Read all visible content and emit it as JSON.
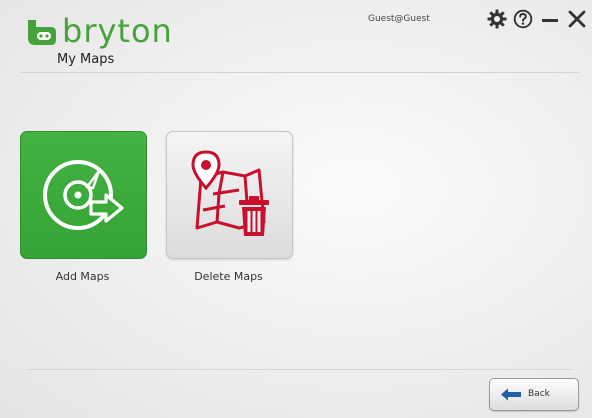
{
  "app": {
    "brand": "bryton",
    "page_title": "My Maps",
    "user": "Guest@Guest"
  },
  "window_controls": [
    {
      "name": "settings",
      "icon": "gear-icon"
    },
    {
      "name": "help",
      "icon": "help-icon"
    },
    {
      "name": "minimize",
      "icon": "minimize-icon"
    },
    {
      "name": "close",
      "icon": "close-icon"
    }
  ],
  "tiles": [
    {
      "label": "Add Maps",
      "icon": "add-maps-icon",
      "color": "#3aaa3a"
    },
    {
      "label": "Delete Maps",
      "icon": "delete-maps-icon",
      "color": "#c8102e"
    }
  ],
  "footer": {
    "back_label": "Back",
    "back_icon": "back-arrow-icon"
  },
  "colors": {
    "brand_green": "#46a33c",
    "delete_red": "#c8102e",
    "back_blue": "#1f5fa8"
  }
}
